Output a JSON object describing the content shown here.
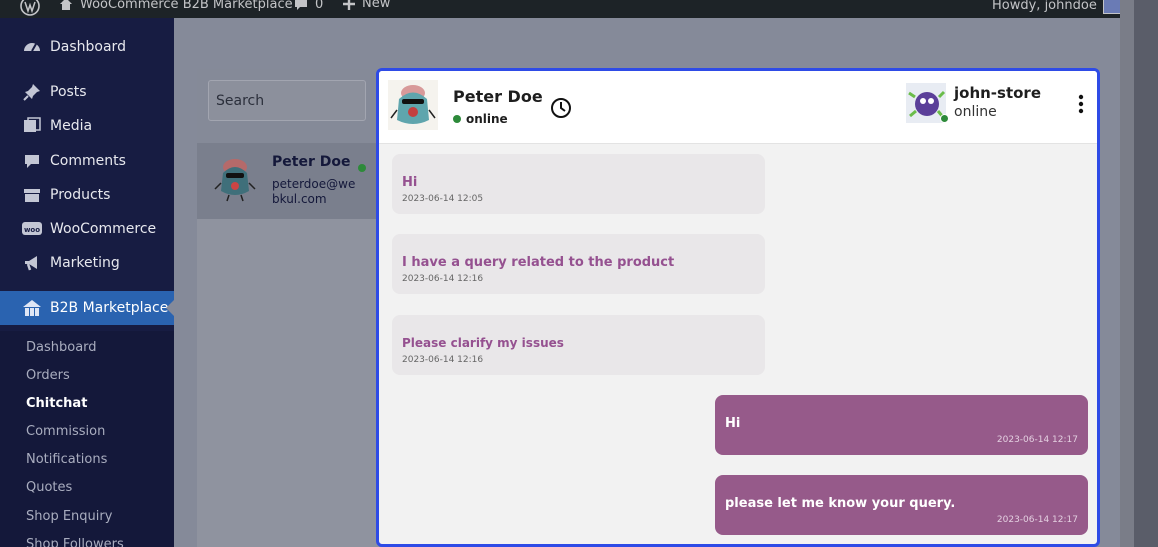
{
  "admin_bar": {
    "site_title": "WooCommerce B2B Marketplace",
    "comments_count": "0",
    "new_label": "New",
    "greeting": "Howdy, johndoe"
  },
  "sidebar": {
    "items": [
      {
        "label": "Dashboard",
        "icon": "dashboard-icon"
      },
      {
        "label": "Posts",
        "icon": "pin-icon"
      },
      {
        "label": "Media",
        "icon": "media-icon"
      },
      {
        "label": "Comments",
        "icon": "comment-icon"
      },
      {
        "label": "Products",
        "icon": "archive-icon"
      },
      {
        "label": "WooCommerce",
        "icon": "woo-icon"
      },
      {
        "label": "Marketing",
        "icon": "megaphone-icon"
      },
      {
        "label": "B2B Marketplace",
        "icon": "store-icon"
      }
    ],
    "submenu": [
      {
        "label": "Dashboard"
      },
      {
        "label": "Orders"
      },
      {
        "label": "Chitchat"
      },
      {
        "label": "Commission"
      },
      {
        "label": "Notifications"
      },
      {
        "label": "Quotes"
      },
      {
        "label": "Shop Enquiry"
      },
      {
        "label": "Shop Followers"
      }
    ]
  },
  "chat_list": {
    "search_placeholder": "Search",
    "contacts": [
      {
        "name": "Peter Doe",
        "email": "peterdoe@webkul.com"
      }
    ]
  },
  "chat": {
    "participant": {
      "name": "Peter Doe",
      "status": "online"
    },
    "store": {
      "name": "john-store",
      "status": "online"
    },
    "messages": [
      {
        "direction": "in",
        "text": "Hi",
        "time": "2023-06-14 12:05"
      },
      {
        "direction": "in",
        "text": "I have a query related to the product",
        "time": "2023-06-14 12:16"
      },
      {
        "direction": "in",
        "text": "Please clarify my issues",
        "time": "2023-06-14 12:16"
      },
      {
        "direction": "out",
        "text": "Hi",
        "time": "2023-06-14 12:17"
      },
      {
        "direction": "out",
        "text": "please let me know your query.",
        "time": "2023-06-14 12:17"
      }
    ]
  },
  "colors": {
    "accent": "#2e4be6",
    "outgoing_bubble": "#965a8a",
    "incoming_text": "#955190",
    "online": "#2d8a3a"
  }
}
